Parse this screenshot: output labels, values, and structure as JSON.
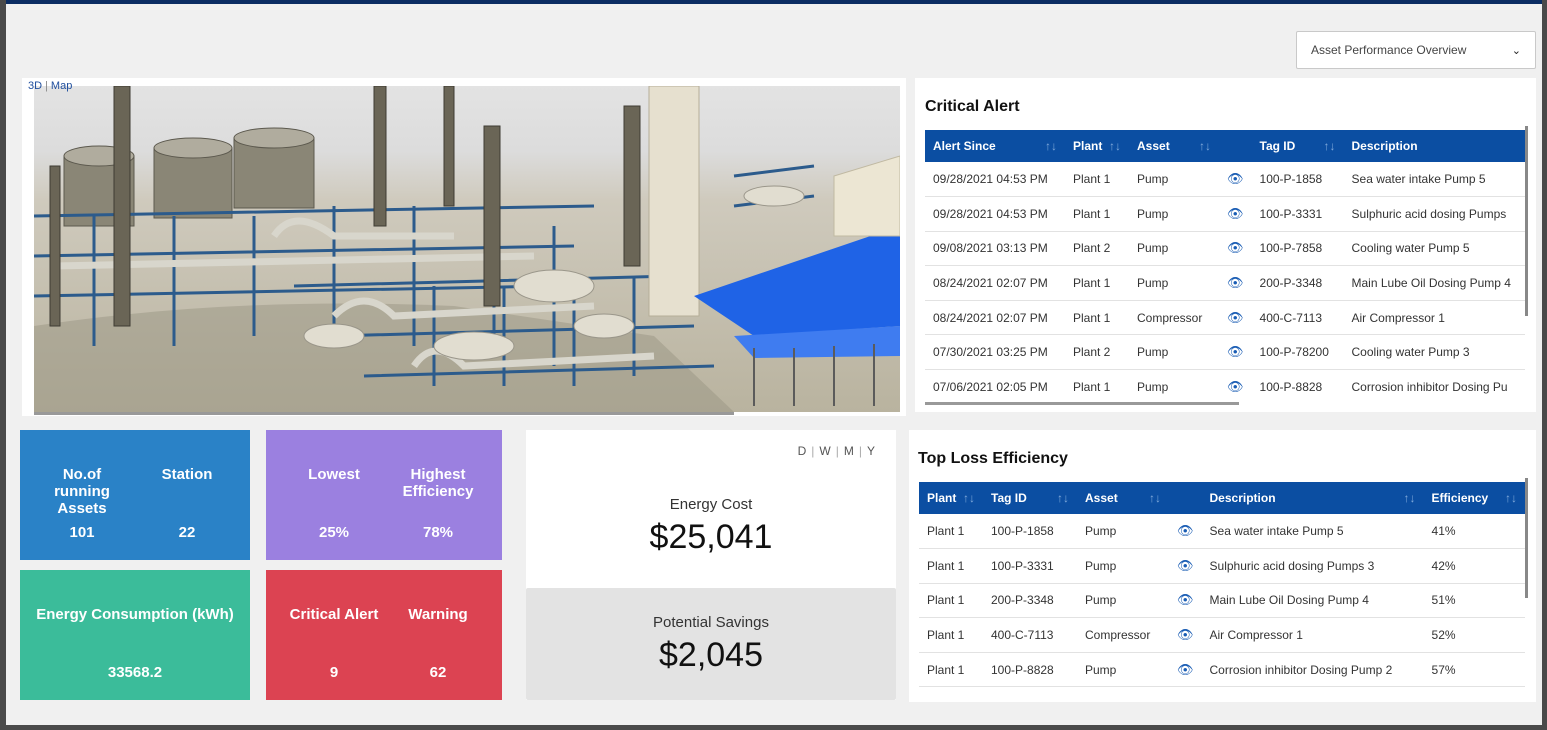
{
  "header": {
    "view_select": "Asset Performance Overview"
  },
  "scene": {
    "mode_3d": "3D",
    "separator": "|",
    "mode_map": "Map"
  },
  "critical_alert": {
    "title": "Critical Alert",
    "columns": [
      "Alert Since",
      "Plant",
      "Asset",
      "",
      "Tag ID",
      "Description"
    ],
    "rows": [
      {
        "since": "09/28/2021 04:53 PM",
        "plant": "Plant 1",
        "asset": "Pump",
        "tag": "100-P-1858",
        "desc": "Sea water intake Pump 5"
      },
      {
        "since": "09/28/2021 04:53 PM",
        "plant": "Plant 1",
        "asset": "Pump",
        "tag": "100-P-3331",
        "desc": "Sulphuric acid dosing Pumps"
      },
      {
        "since": "09/08/2021 03:13 PM",
        "plant": "Plant 2",
        "asset": "Pump",
        "tag": "100-P-7858",
        "desc": "Cooling water Pump 5"
      },
      {
        "since": "08/24/2021 02:07 PM",
        "plant": "Plant 1",
        "asset": "Pump",
        "tag": "200-P-3348",
        "desc": "Main Lube Oil Dosing Pump 4"
      },
      {
        "since": "08/24/2021 02:07 PM",
        "plant": "Plant 1",
        "asset": "Compressor",
        "tag": "400-C-7113",
        "desc": "Air Compressor 1"
      },
      {
        "since": "07/30/2021 03:25 PM",
        "plant": "Plant 2",
        "asset": "Pump",
        "tag": "100-P-78200",
        "desc": "Cooling water Pump 3"
      },
      {
        "since": "07/06/2021 02:05 PM",
        "plant": "Plant 1",
        "asset": "Pump",
        "tag": "100-P-8828",
        "desc": "Corrosion inhibitor Dosing Pu"
      }
    ]
  },
  "top_loss": {
    "title": "Top Loss Efficiency",
    "columns": [
      "Plant",
      "Tag ID",
      "Asset",
      "",
      "Description",
      "Efficiency"
    ],
    "rows": [
      {
        "plant": "Plant 1",
        "tag": "100-P-1858",
        "asset": "Pump",
        "desc": "Sea water intake Pump 5",
        "eff": "41%"
      },
      {
        "plant": "Plant 1",
        "tag": "100-P-3331",
        "asset": "Pump",
        "desc": "Sulphuric acid dosing Pumps 3",
        "eff": "42%"
      },
      {
        "plant": "Plant 1",
        "tag": "200-P-3348",
        "asset": "Pump",
        "desc": "Main Lube Oil Dosing Pump 4",
        "eff": "51%"
      },
      {
        "plant": "Plant 1",
        "tag": "400-C-7113",
        "asset": "Compressor",
        "desc": "Air Compressor 1",
        "eff": "52%"
      },
      {
        "plant": "Plant 1",
        "tag": "100-P-8828",
        "asset": "Pump",
        "desc": "Corrosion inhibitor Dosing Pump 2",
        "eff": "57%"
      }
    ]
  },
  "tiles": {
    "running_assets_label": "No.of running Assets",
    "running_assets_value": "101",
    "station_label": "Station",
    "station_value": "22",
    "lowest_label": "Lowest",
    "lowest_value": "25%",
    "highest_label": "Highest Efficiency",
    "highest_value": "78%",
    "energy_consumption_label": "Energy Consumption (kWh)",
    "energy_consumption_value": "33568.2",
    "critical_alert_label": "Critical Alert",
    "critical_alert_value": "9",
    "warning_label": "Warning",
    "warning_value": "62"
  },
  "energy": {
    "periods": [
      "D",
      "W",
      "M",
      "Y"
    ],
    "cost_label": "Energy Cost",
    "cost_value": "$25,041",
    "savings_label": "Potential Savings",
    "savings_value": "$2,045"
  },
  "icons": {
    "sort": "sort-arrows-icon",
    "view": "eye-icon",
    "dropdown": "chevron-down-icon"
  },
  "colors": {
    "header_blue": "#0b4ea2",
    "tile_blue": "#2a82c7",
    "tile_purple": "#9b80e0",
    "tile_teal": "#3bbc9a",
    "tile_red": "#dc4352"
  }
}
